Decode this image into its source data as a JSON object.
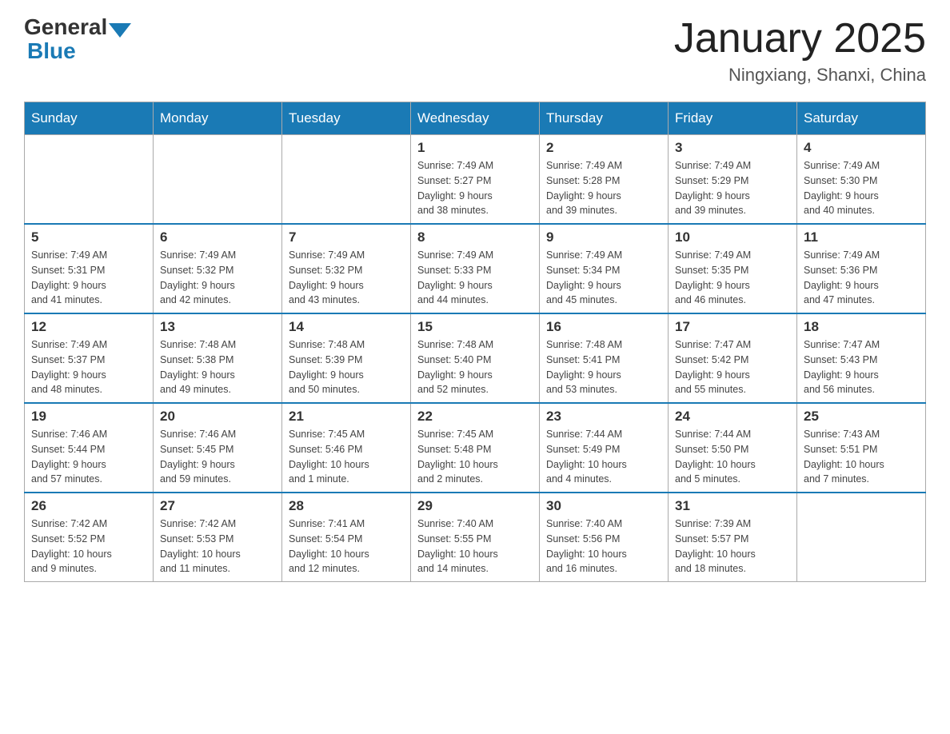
{
  "logo": {
    "general": "General",
    "blue": "Blue"
  },
  "title": "January 2025",
  "location": "Ningxiang, Shanxi, China",
  "days_of_week": [
    "Sunday",
    "Monday",
    "Tuesday",
    "Wednesday",
    "Thursday",
    "Friday",
    "Saturday"
  ],
  "weeks": [
    [
      {
        "day": "",
        "info": ""
      },
      {
        "day": "",
        "info": ""
      },
      {
        "day": "",
        "info": ""
      },
      {
        "day": "1",
        "info": "Sunrise: 7:49 AM\nSunset: 5:27 PM\nDaylight: 9 hours\nand 38 minutes."
      },
      {
        "day": "2",
        "info": "Sunrise: 7:49 AM\nSunset: 5:28 PM\nDaylight: 9 hours\nand 39 minutes."
      },
      {
        "day": "3",
        "info": "Sunrise: 7:49 AM\nSunset: 5:29 PM\nDaylight: 9 hours\nand 39 minutes."
      },
      {
        "day": "4",
        "info": "Sunrise: 7:49 AM\nSunset: 5:30 PM\nDaylight: 9 hours\nand 40 minutes."
      }
    ],
    [
      {
        "day": "5",
        "info": "Sunrise: 7:49 AM\nSunset: 5:31 PM\nDaylight: 9 hours\nand 41 minutes."
      },
      {
        "day": "6",
        "info": "Sunrise: 7:49 AM\nSunset: 5:32 PM\nDaylight: 9 hours\nand 42 minutes."
      },
      {
        "day": "7",
        "info": "Sunrise: 7:49 AM\nSunset: 5:32 PM\nDaylight: 9 hours\nand 43 minutes."
      },
      {
        "day": "8",
        "info": "Sunrise: 7:49 AM\nSunset: 5:33 PM\nDaylight: 9 hours\nand 44 minutes."
      },
      {
        "day": "9",
        "info": "Sunrise: 7:49 AM\nSunset: 5:34 PM\nDaylight: 9 hours\nand 45 minutes."
      },
      {
        "day": "10",
        "info": "Sunrise: 7:49 AM\nSunset: 5:35 PM\nDaylight: 9 hours\nand 46 minutes."
      },
      {
        "day": "11",
        "info": "Sunrise: 7:49 AM\nSunset: 5:36 PM\nDaylight: 9 hours\nand 47 minutes."
      }
    ],
    [
      {
        "day": "12",
        "info": "Sunrise: 7:49 AM\nSunset: 5:37 PM\nDaylight: 9 hours\nand 48 minutes."
      },
      {
        "day": "13",
        "info": "Sunrise: 7:48 AM\nSunset: 5:38 PM\nDaylight: 9 hours\nand 49 minutes."
      },
      {
        "day": "14",
        "info": "Sunrise: 7:48 AM\nSunset: 5:39 PM\nDaylight: 9 hours\nand 50 minutes."
      },
      {
        "day": "15",
        "info": "Sunrise: 7:48 AM\nSunset: 5:40 PM\nDaylight: 9 hours\nand 52 minutes."
      },
      {
        "day": "16",
        "info": "Sunrise: 7:48 AM\nSunset: 5:41 PM\nDaylight: 9 hours\nand 53 minutes."
      },
      {
        "day": "17",
        "info": "Sunrise: 7:47 AM\nSunset: 5:42 PM\nDaylight: 9 hours\nand 55 minutes."
      },
      {
        "day": "18",
        "info": "Sunrise: 7:47 AM\nSunset: 5:43 PM\nDaylight: 9 hours\nand 56 minutes."
      }
    ],
    [
      {
        "day": "19",
        "info": "Sunrise: 7:46 AM\nSunset: 5:44 PM\nDaylight: 9 hours\nand 57 minutes."
      },
      {
        "day": "20",
        "info": "Sunrise: 7:46 AM\nSunset: 5:45 PM\nDaylight: 9 hours\nand 59 minutes."
      },
      {
        "day": "21",
        "info": "Sunrise: 7:45 AM\nSunset: 5:46 PM\nDaylight: 10 hours\nand 1 minute."
      },
      {
        "day": "22",
        "info": "Sunrise: 7:45 AM\nSunset: 5:48 PM\nDaylight: 10 hours\nand 2 minutes."
      },
      {
        "day": "23",
        "info": "Sunrise: 7:44 AM\nSunset: 5:49 PM\nDaylight: 10 hours\nand 4 minutes."
      },
      {
        "day": "24",
        "info": "Sunrise: 7:44 AM\nSunset: 5:50 PM\nDaylight: 10 hours\nand 5 minutes."
      },
      {
        "day": "25",
        "info": "Sunrise: 7:43 AM\nSunset: 5:51 PM\nDaylight: 10 hours\nand 7 minutes."
      }
    ],
    [
      {
        "day": "26",
        "info": "Sunrise: 7:42 AM\nSunset: 5:52 PM\nDaylight: 10 hours\nand 9 minutes."
      },
      {
        "day": "27",
        "info": "Sunrise: 7:42 AM\nSunset: 5:53 PM\nDaylight: 10 hours\nand 11 minutes."
      },
      {
        "day": "28",
        "info": "Sunrise: 7:41 AM\nSunset: 5:54 PM\nDaylight: 10 hours\nand 12 minutes."
      },
      {
        "day": "29",
        "info": "Sunrise: 7:40 AM\nSunset: 5:55 PM\nDaylight: 10 hours\nand 14 minutes."
      },
      {
        "day": "30",
        "info": "Sunrise: 7:40 AM\nSunset: 5:56 PM\nDaylight: 10 hours\nand 16 minutes."
      },
      {
        "day": "31",
        "info": "Sunrise: 7:39 AM\nSunset: 5:57 PM\nDaylight: 10 hours\nand 18 minutes."
      },
      {
        "day": "",
        "info": ""
      }
    ]
  ]
}
